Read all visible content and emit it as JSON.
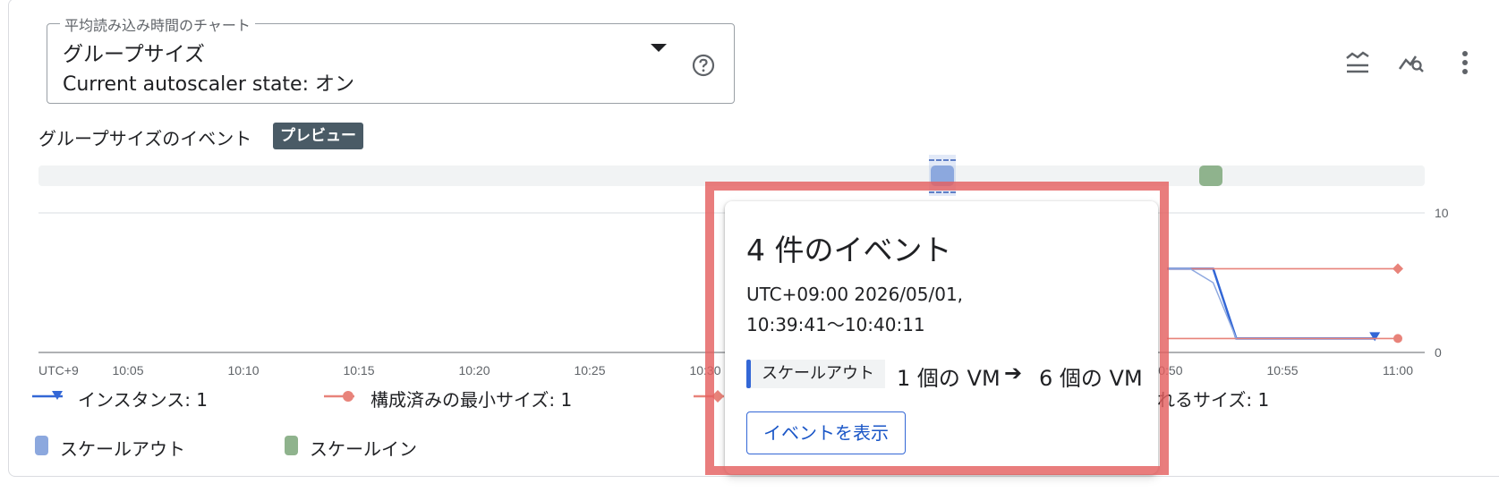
{
  "selector": {
    "legend": "平均読み込み時間のチャート",
    "value": "グループサイズ",
    "state_text": "Current autoscaler state: オン"
  },
  "toolbar": {
    "icons": [
      "series-toggle-icon",
      "chart-explore-icon",
      "more-vert-icon"
    ]
  },
  "events_section": {
    "label": "グループサイズのイベント",
    "badge": "プレビュー"
  },
  "chart_data": {
    "type": "line",
    "x": [
      "10:05",
      "10:10",
      "10:15",
      "10:20",
      "10:25",
      "10:30",
      "10:50",
      "10:55",
      "11:00"
    ],
    "x_prefix": "UTC+9",
    "yticks": [
      0,
      10
    ],
    "ylim": [
      0,
      10
    ],
    "series": [
      {
        "name": "インスタンス: 1",
        "color": "#3367d6",
        "marker": "triangle-down",
        "points": [
          [
            "10:50",
            6
          ],
          [
            "10:52",
            6
          ],
          [
            "10:53",
            1
          ],
          [
            "10:59",
            1
          ]
        ]
      },
      {
        "name": "構成済みの最小サイズ: 1",
        "color": "#e8837a",
        "marker": "circle",
        "points": [
          [
            "10:50",
            1
          ],
          [
            "11:00",
            1
          ]
        ]
      },
      {
        "name": "れるサイズ: 1",
        "color": "#e8837a",
        "marker": "diamond",
        "points": [
          [
            "10:50",
            6
          ],
          [
            "11:00",
            6
          ]
        ]
      }
    ]
  },
  "legend": {
    "instances": "インスタンス: 1",
    "min_size": "構成済みの最小サイズ: 1",
    "partial_size": "れるサイズ: 1",
    "scale_out": "スケールアウト",
    "scale_in": "スケールイン"
  },
  "popup": {
    "title": "4 件のイベント",
    "date_line1": "UTC+09:00 2026/05/01,",
    "date_line2": "10:39:41〜10:40:11",
    "chip": "スケールアウト",
    "from": "1 個の VM",
    "arrow": "➔",
    "to": "6 個の VM",
    "button": "イベントを表示"
  },
  "colors": {
    "scale_out": "#8ca8de",
    "scale_in": "#8fb38d",
    "instances": "#3367d6",
    "min_size": "#e8837a",
    "highlight": "#e46060"
  }
}
